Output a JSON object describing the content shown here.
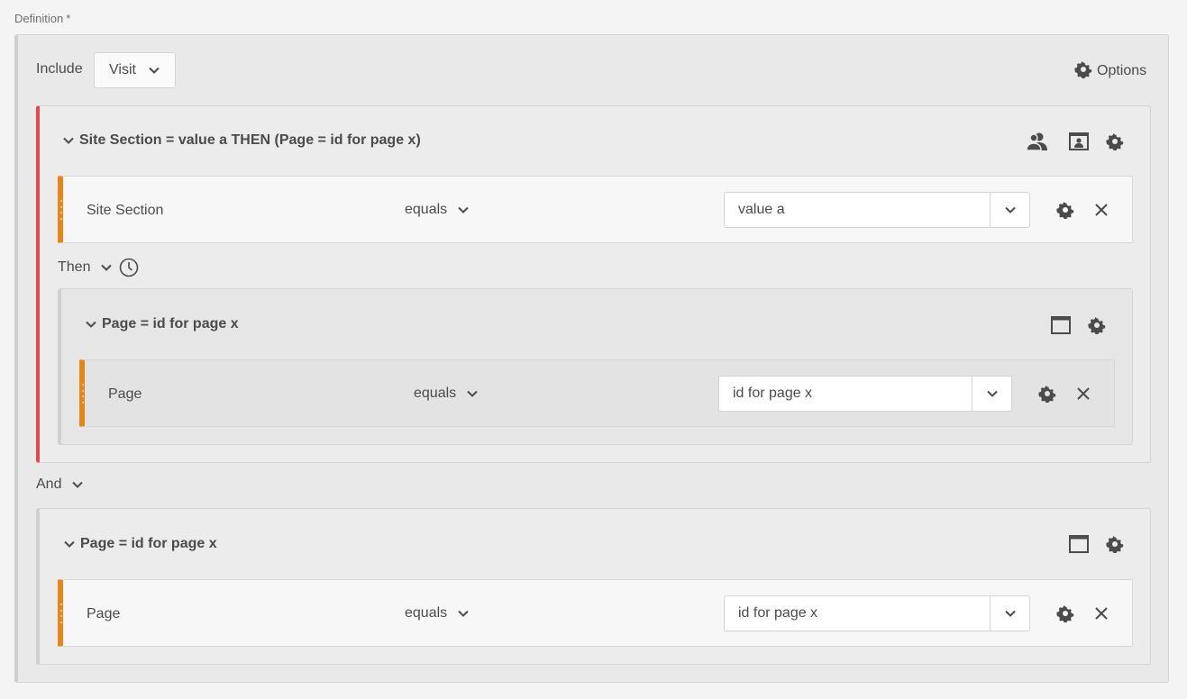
{
  "definition": {
    "label": "Definition",
    "required_mark": "*"
  },
  "header": {
    "include_label": "Include",
    "scope_value": "Visit",
    "options_label": "Options"
  },
  "container_visit": {
    "title": "Site Section = value a THEN (Page = id for page x)",
    "rule": {
      "dimension": "Site Section",
      "operator": "equals",
      "value": "value a"
    },
    "then_label": "Then",
    "nested_container": {
      "title": "Page = id for page x",
      "rule": {
        "dimension": "Page",
        "operator": "equals",
        "value": "id for page x"
      }
    }
  },
  "and_label": "And",
  "container_hit": {
    "title": "Page = id for page x",
    "rule": {
      "dimension": "Page",
      "operator": "equals",
      "value": "id for page x"
    }
  },
  "colors": {
    "sequential_bar": "#e34850",
    "rule_bar": "#e68619",
    "background": "#f4f4f4"
  }
}
